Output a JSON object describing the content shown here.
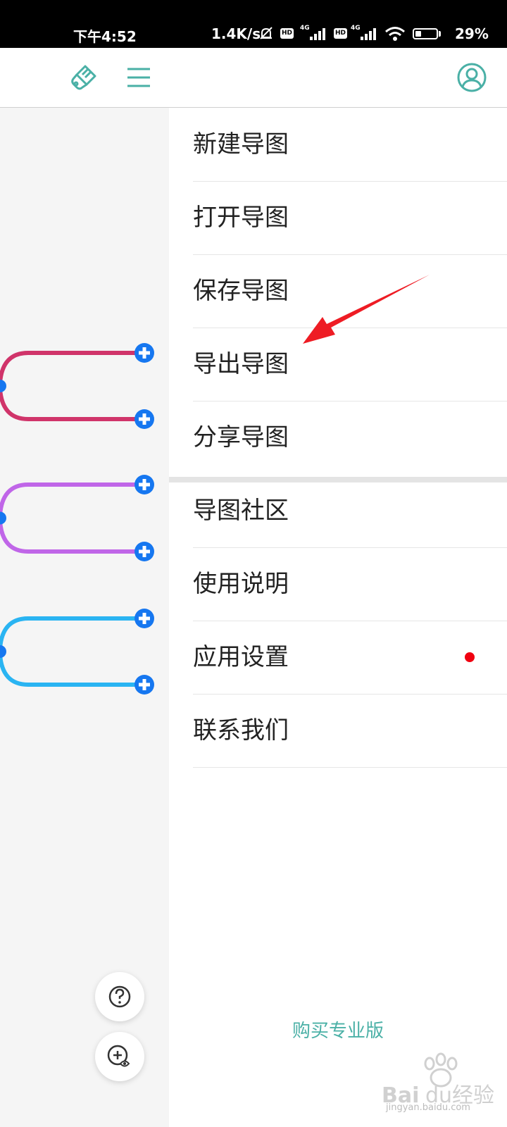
{
  "status_bar": {
    "time": "下午4:52",
    "net_speed": "1.4K/s",
    "hd1": "HD",
    "hd2": "HD",
    "sig1_label": "4G",
    "sig2_label": "4G",
    "battery_percent": "29%",
    "battery_level": 0.29
  },
  "toolbar": {
    "theme_icon": "brush-icon",
    "menu_icon": "hamburger-menu-icon",
    "account_icon": "user-account-icon",
    "accent_color": "#4ab0a6"
  },
  "menu": {
    "items": [
      {
        "label": "新建导图"
      },
      {
        "label": "打开导图"
      },
      {
        "label": "保存导图"
      },
      {
        "label": "导出导图"
      },
      {
        "label": "分享导图"
      },
      {
        "label": "导图社区"
      },
      {
        "label": "使用说明"
      },
      {
        "label": "应用设置"
      },
      {
        "label": "联系我们"
      }
    ],
    "buy_pro": "购买专业版",
    "settings_badge_color": "#f00010"
  },
  "mindmap": {
    "branch_colors": [
      "#d0346a",
      "#c066e8",
      "#2ab4f2"
    ],
    "add_node_color": "#1677f0"
  },
  "fabs": {
    "help_icon": "question-circle-icon",
    "preview_icon": "zoom-eye-icon"
  },
  "annotation": {
    "arrow_color": "#ee1c24"
  },
  "watermark": {
    "text": "jingyan.baidu.com",
    "logo": "Baidu经验"
  }
}
